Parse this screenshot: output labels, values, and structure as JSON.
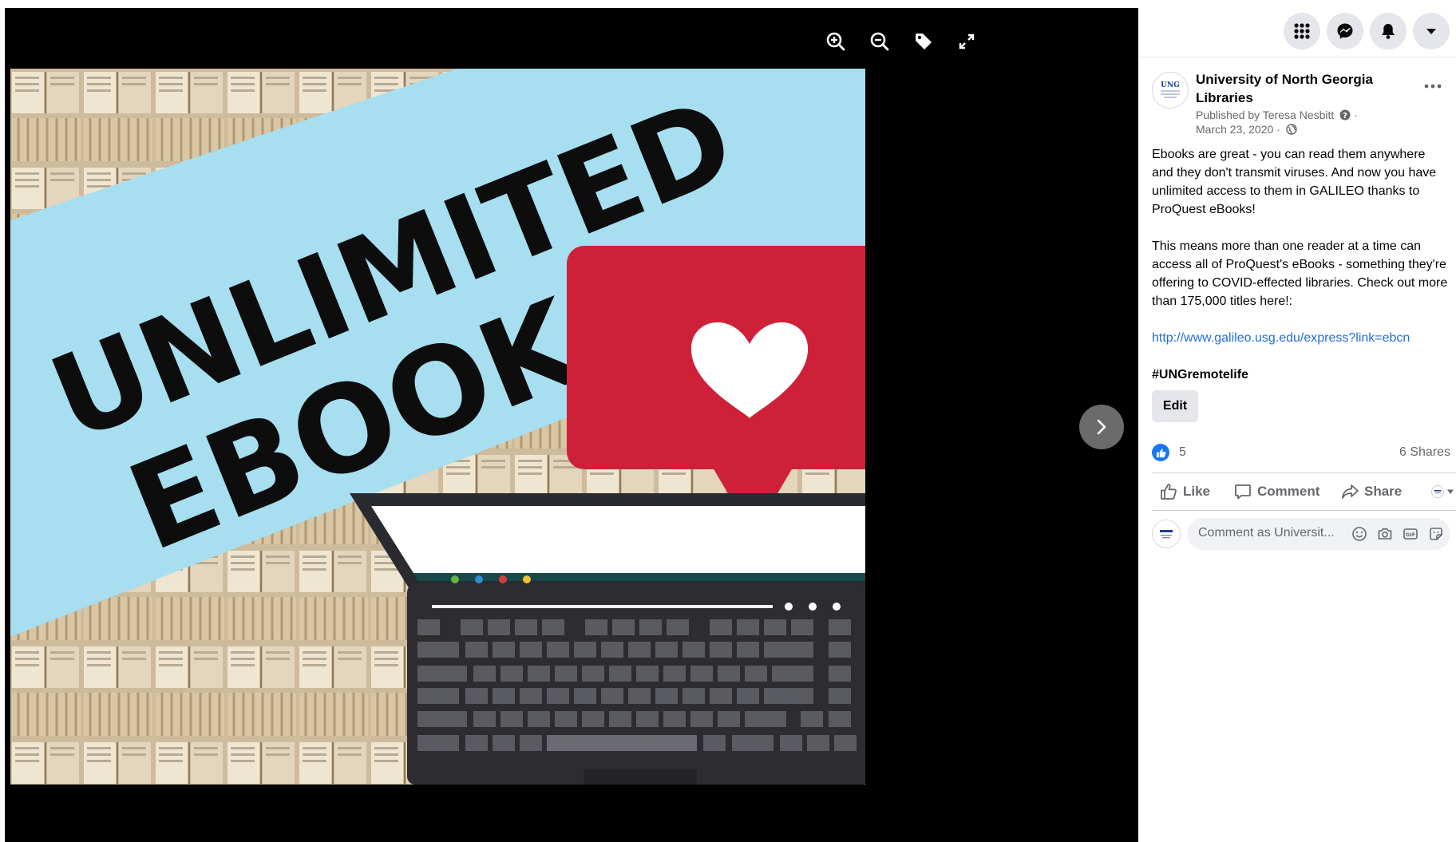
{
  "viewer": {
    "tools": {
      "zoom_in": "zoom-in-icon",
      "zoom_out": "zoom-out-icon",
      "tag": "tag-icon",
      "fullscreen": "fullscreen-icon"
    },
    "next": "chevron-right-icon"
  },
  "photo": {
    "line1": "UNLIMITED",
    "line2": "EBOOKS",
    "banner_color": "#a7def0",
    "bubble_color": "#cf203a"
  },
  "topbar": {
    "buttons": [
      "menu-grid-icon",
      "messenger-icon",
      "notifications-icon",
      "account-caret-icon"
    ]
  },
  "post": {
    "page_name": "University of North Georgia Libraries",
    "avatar_text": "UNG",
    "published_by": "Published by Teresa Nesbitt",
    "date": "March 23, 2020 ·",
    "paragraph1": "Ebooks are great - you can read them anywhere and they don't transmit viruses. And now you have unlimited access to them in GALILEO thanks to ProQuest eBooks!",
    "paragraph2": "This means more than one reader at a time can access all of ProQuest's eBooks - something they're offering to COVID-effected libraries. Check out more than 175,000 titles here!:",
    "link": "http://www.galileo.usg.edu/express?link=ebcn",
    "hashtag": "#UNGremotelife",
    "edit_label": "Edit"
  },
  "stats": {
    "reactions": "5",
    "shares": "6 Shares"
  },
  "actions": {
    "like": "Like",
    "comment": "Comment",
    "share": "Share"
  },
  "comment_box": {
    "placeholder": "Comment as Universit..."
  },
  "colors": {
    "link": "#216fdb",
    "accent": "#1877f2",
    "secondary_text": "#65676b"
  }
}
